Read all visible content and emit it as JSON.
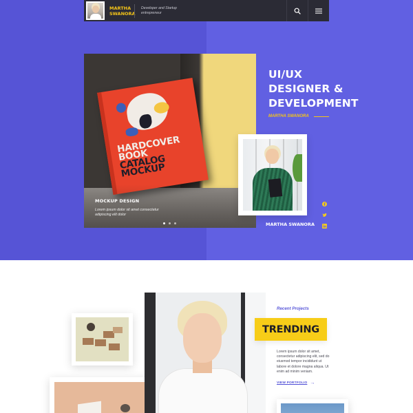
{
  "header": {
    "brand_name": "MARTHA SWANORA",
    "tagline": "Developer and Startup entrepreneur",
    "search_icon": "search-icon",
    "menu_icon": "hamburger-menu-icon"
  },
  "hero": {
    "headline_line1": "UI/UX",
    "headline_line2": "DESIGNER &",
    "headline_line3": "DEVELOPMENT",
    "subtitle_name": "MARTHA SWANORA",
    "card": {
      "book_line1": "HARDCOVER",
      "book_line2": "BOOK",
      "book_line3": "CATALOG",
      "book_line4": "MOCKUP",
      "title": "MOCKUP DESIGN",
      "description": "Lorem ipsum dolor sit amet consectetur adipiscing elit dolor"
    },
    "slider_dots": 3,
    "slider_active_index": 0,
    "portrait_name": "MARTHA SWANORA",
    "social_icons": [
      "facebook-icon",
      "twitter-icon",
      "linkedin-icon"
    ]
  },
  "section2": {
    "recent_label": "Recent Projects",
    "trending_label": "TRENDING",
    "body_text": "Lorem ipsum dolor sit amet, consectetur adipiscing elit, sed do eiusmod tempor incididunt ut labore et dolore magna aliqua. Ut enim ad minim veniam.",
    "view_portfolio_label": "VIEW PORTFOLIO",
    "arrow_icon": "arrow-right-icon"
  },
  "colors": {
    "hero_bg": "#6160e2",
    "accent_yellow": "#f7cd18",
    "header_dark": "#2b2b35",
    "link_purple": "#4e4dd6"
  }
}
